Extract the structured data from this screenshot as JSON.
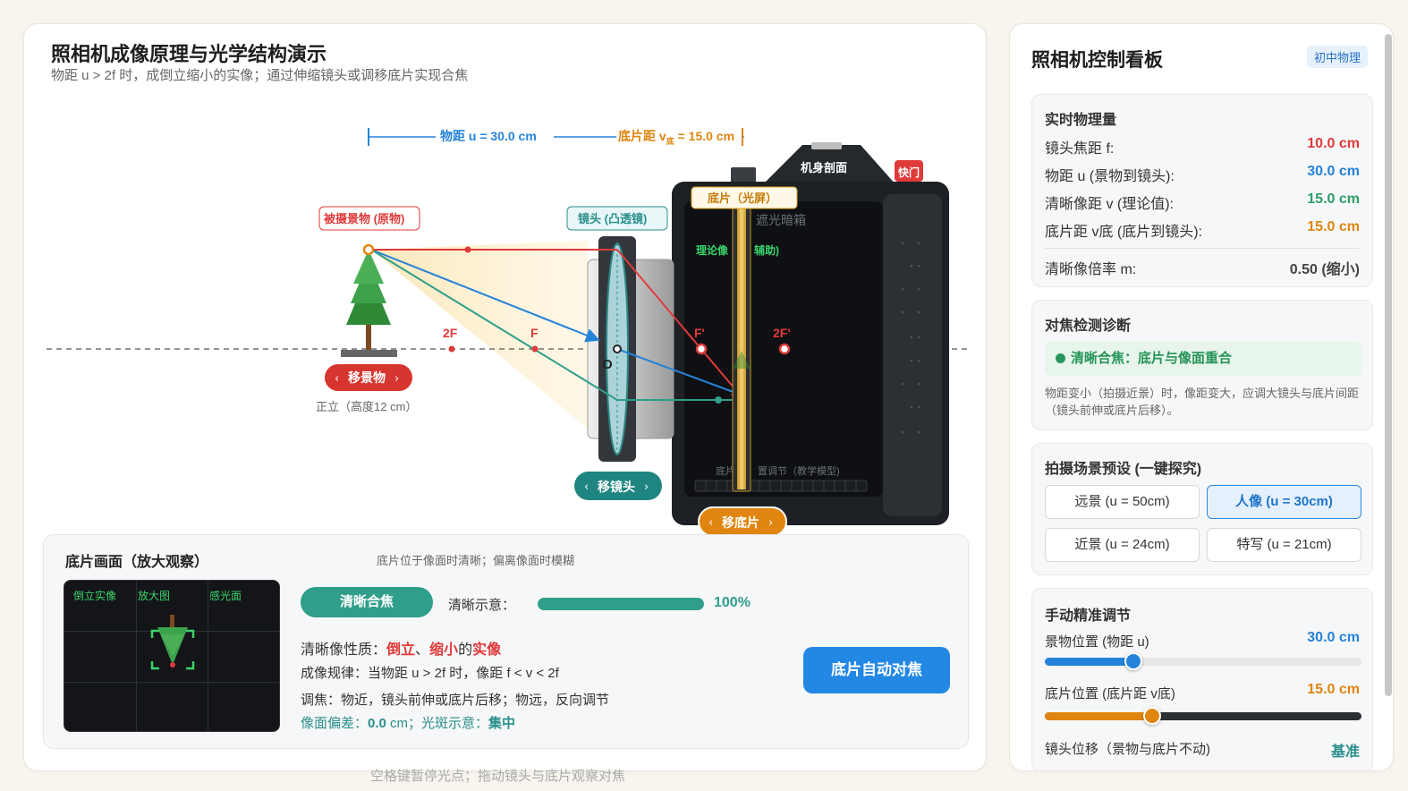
{
  "main": {
    "title": "照相机成像原理与光学结构演示",
    "subtitle": "物距 u > 2f 时，成倒立缩小的实像；通过伸缩镜头或调移底片实现合焦"
  },
  "diagram": {
    "u_measure": "物距 u = 30.0 cm",
    "v_measure_prefix": "底片距 v",
    "v_measure_sub": "底",
    "v_measure_suffix": " = 15.0 cm",
    "object_tag": "被摄景物 (原物)",
    "lens_tag": "镜头 (凸透镜)",
    "film_tag": "底片（光屏）",
    "body_label": "机身剖面",
    "shutter_label": "快门",
    "darkbox_label": "遮光暗箱",
    "theory_label_left": "理论像",
    "theory_label_right": "辅助)",
    "film_adjust_label_left": "底片",
    "film_adjust_label_right": "置调节（教学模型)",
    "label_2f": "2F",
    "label_f": "F",
    "label_f_prime": "F'",
    "label_2f_prime": "2F'",
    "label_o": "O",
    "move_object": "移景物",
    "move_lens": "移镜头",
    "move_film": "移底片",
    "object_note": "正立（高度12 cm）"
  },
  "film_view": {
    "title": "底片画面（放大观察）",
    "hint": "底片位于像面时清晰；偏离像面时模糊",
    "screen_labels": [
      "倒立实像",
      "放大图",
      "感光面"
    ],
    "focus_badge": "清晰合焦",
    "clarity_label": "清晰示意：",
    "clarity_percent": 100,
    "clarity_text": "100%",
    "prop_prefix": "清晰像性质：",
    "prop_a": "倒立",
    "prop_sep": "、",
    "prop_b": "缩小",
    "prop_mid": "的",
    "prop_c": "实像",
    "rule": "成像规律：当物距 u > 2f 时，像距 f < v < 2f",
    "adjust": "调焦：物近，镜头前伸或底片后移；物远，反向调节",
    "deviation_label": "像面偏差：",
    "deviation_value": "0.0",
    "deviation_unit": " cm；光斑示意：",
    "spot_value": "集中",
    "autofocus_button": "底片自动对焦"
  },
  "footer_hint": "空格键暂停光点；拖动镜头与底片观察对焦",
  "side": {
    "title": "照相机控制看板",
    "tag": "初中物理",
    "realtime": {
      "title": "实时物理量",
      "rows": [
        {
          "label": "镜头焦距 f:",
          "value": "10.0 cm",
          "color": "#e03a3a"
        },
        {
          "label": "物距 u (景物到镜头):",
          "value": "30.0 cm",
          "color": "#2583d9"
        },
        {
          "label": "清晰像距 v (理论值):",
          "value": "15.0 cm",
          "color": "#2f9e6a"
        },
        {
          "label": "底片距 v底 (底片到镜头):",
          "value": "15.0 cm",
          "color": "#e0850f"
        }
      ],
      "magnification_label": "清晰像倍率 m:",
      "magnification_value": "0.50 (缩小)"
    },
    "diagnosis": {
      "title": "对焦检测诊断",
      "status": "清晰合焦：底片与像面重合",
      "text": "物距变小（拍摄近景）时，像距变大，应调大镜头与底片间距（镜头前伸或底片后移）。"
    },
    "presets": {
      "title": "拍摄场景预设 (一键探究)",
      "items": [
        {
          "label": "远景 (u = 50cm)",
          "active": false
        },
        {
          "label": "人像 (u = 30cm)",
          "active": true
        },
        {
          "label": "近景 (u = 24cm)",
          "active": false
        },
        {
          "label": "特写 (u = 21cm)",
          "active": false
        }
      ]
    },
    "manual": {
      "title": "手动精准调节",
      "object_label": "景物位置 (物距 u)",
      "object_value": "30.0 cm",
      "object_fraction": 0.28,
      "film_label": "底片位置 (底片距 v底)",
      "film_value": "15.0 cm",
      "film_fraction": 0.34,
      "lens_label": "镜头位移（景物与底片不动)",
      "lens_value": "基准"
    }
  },
  "colors": {
    "red": "#e03a3a",
    "blue": "#2583d9",
    "green": "#2f9e6a",
    "orange": "#e0850f",
    "teal": "#2a8f8c"
  }
}
